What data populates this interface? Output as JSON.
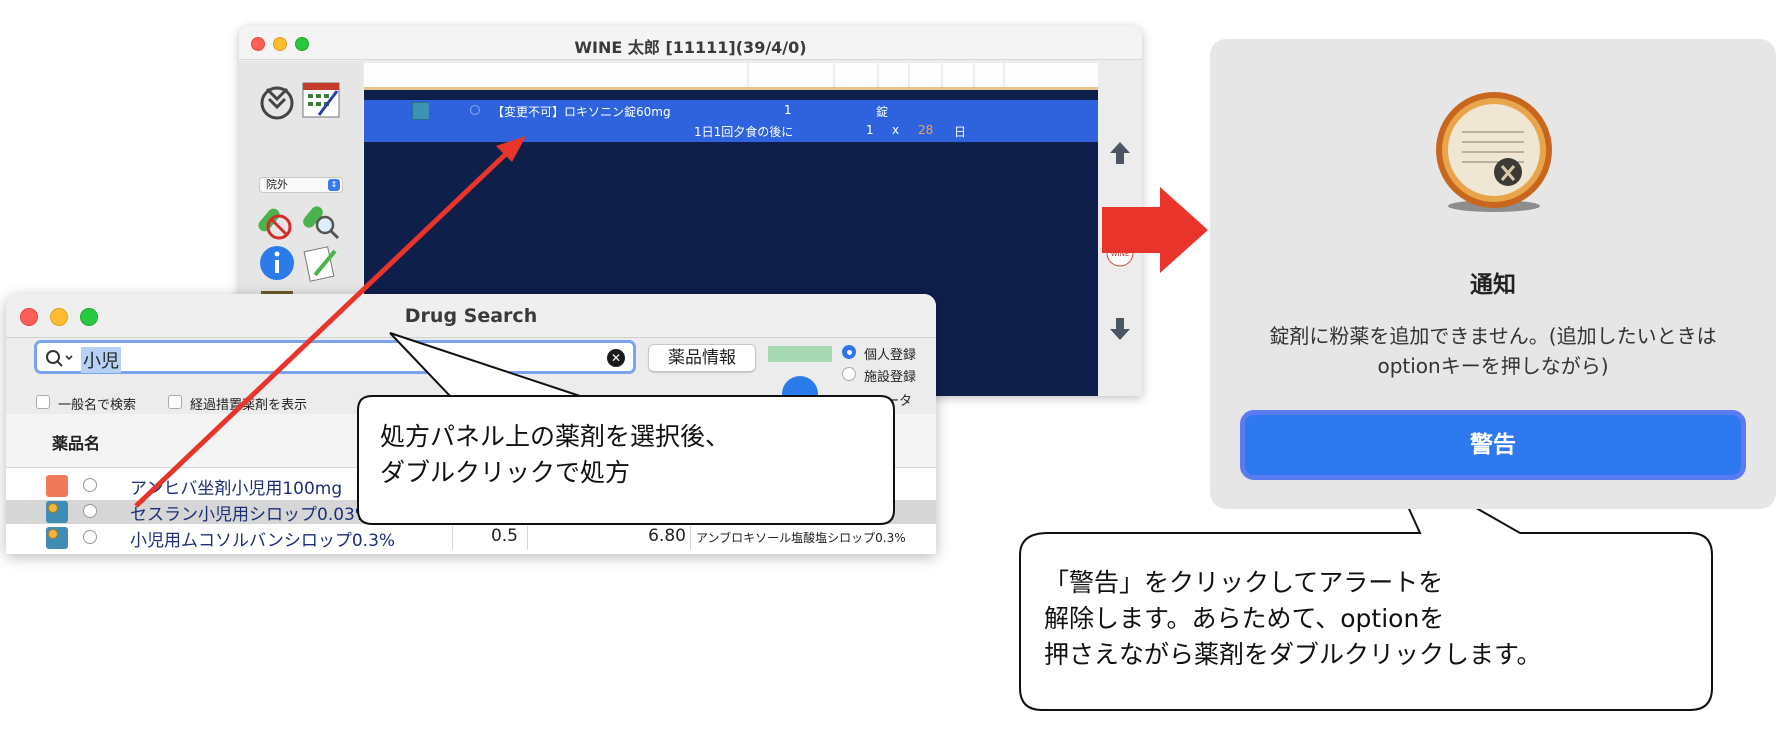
{
  "wine_window": {
    "title": "WINE 太郎 [11111](39/4/0)",
    "location_select": "院外",
    "rx_line1": {
      "drug": "【変更不可】ロキソニン錠60mg",
      "qty": "1",
      "unit": "錠"
    },
    "rx_line2": {
      "usage": "1日1回夕食の後に",
      "dose": "1",
      "x": "x",
      "days": "28",
      "days_unit": "日"
    },
    "arrow_up_icon": "arrow-up-icon",
    "arrow_down_icon": "arrow-down-icon"
  },
  "drug_search": {
    "title": "Drug Search",
    "search_value": "小児",
    "info_button": "薬品情報",
    "radio_personal": "個人登録",
    "radio_facility": "施設登録",
    "radio_data_suffix": "ータ",
    "check_generic": "一般名で検索",
    "check_transitional": "経過措置薬剤を表示",
    "table_header": "薬品名",
    "rows": [
      {
        "name": "アンヒバ坐剤小児用100mg",
        "c1": "",
        "c2": "",
        "c3": "",
        "color": "#ee7a5b",
        "dot": false
      },
      {
        "name": "セスラン小児用シロップ0.03%",
        "c1": "",
        "c2": "",
        "c3": "",
        "color": "#3f8cb5",
        "dot": true
      },
      {
        "name": "小児用ムコソルバンシロップ0.3%",
        "c1": "0.5",
        "c2": "6.80",
        "c3": "アンブロキソール塩酸塩シロップ0.3%",
        "color": "#3f8cb5",
        "dot": true
      }
    ]
  },
  "notification": {
    "title": "通知",
    "message": "錠剤に粉薬を追加できません。(追加したいときはoptionキーを押しながら)",
    "button": "警告"
  },
  "callouts": {
    "left_line1": "処方パネル上の薬剤を選択後、",
    "left_line2": "ダブルクリックで処方",
    "right_line1": "「警告」をクリックしてアラートを",
    "right_line2": "解除します。あらためて、optionを",
    "right_line3": "押さえながら薬剤をダブルクリックします。"
  },
  "colors": {
    "rx_panel": "#0e1f4a",
    "rx_selected": "#2f63dd",
    "accent_blue": "#2f79f0",
    "red_arrow": "#e8342a"
  }
}
